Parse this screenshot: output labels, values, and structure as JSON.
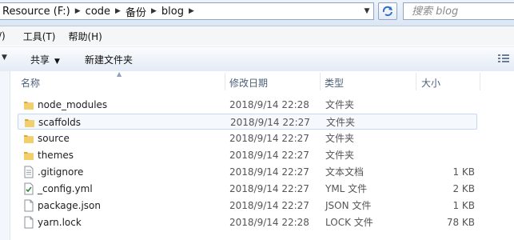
{
  "address": {
    "crumbs": [
      "Resource (F:)",
      "code",
      "备份",
      "blog"
    ]
  },
  "search": {
    "placeholder": "搜索 blog"
  },
  "menu": [
    "/)",
    "工具(T)",
    "帮助(H)"
  ],
  "toolbar": {
    "share_label": "共享",
    "new_folder_label": "新建文件夹"
  },
  "columns": {
    "name": "名称",
    "date": "修改日期",
    "type": "类型",
    "size": "大小"
  },
  "files": [
    {
      "name": "node_modules",
      "date": "2018/9/14 22:28",
      "type": "文件夹",
      "size": "",
      "icon": "folder-icon"
    },
    {
      "name": "scaffolds",
      "date": "2018/9/14 22:27",
      "type": "文件夹",
      "size": "",
      "icon": "folder-icon",
      "selected": true
    },
    {
      "name": "source",
      "date": "2018/9/14 22:27",
      "type": "文件夹",
      "size": "",
      "icon": "folder-icon"
    },
    {
      "name": "themes",
      "date": "2018/9/14 22:27",
      "type": "文件夹",
      "size": "",
      "icon": "folder-icon"
    },
    {
      "name": ".gitignore",
      "date": "2018/9/14 22:27",
      "type": "文本文档",
      "size": "1 KB",
      "icon": "text-file-icon"
    },
    {
      "name": "_config.yml",
      "date": "2018/9/14 22:27",
      "type": "YML 文件",
      "size": "2 KB",
      "icon": "yml-file-icon"
    },
    {
      "name": "package.json",
      "date": "2018/9/14 22:27",
      "type": "JSON 文件",
      "size": "1 KB",
      "icon": "file-icon"
    },
    {
      "name": "yarn.lock",
      "date": "2018/9/14 22:28",
      "type": "LOCK 文件",
      "size": "78 KB",
      "icon": "file-icon"
    }
  ],
  "colors": {
    "folder": "#e8c15a",
    "selection_border": "#c4d8ef",
    "header_text": "#4c607a"
  }
}
